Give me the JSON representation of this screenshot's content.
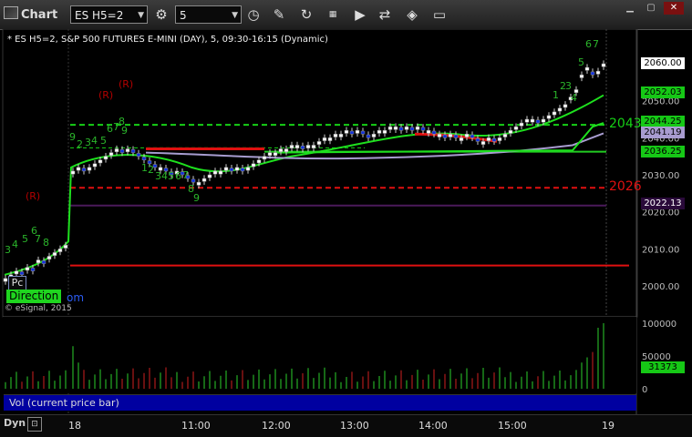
{
  "window": {
    "title": "Chart",
    "symbol_value": "ES H5=2",
    "interval_value": "5",
    "minimize_icon": "minimize-icon",
    "maximize_icon": "maximize-icon",
    "close_icon": "close-icon"
  },
  "toolbar": {
    "icons": [
      "link-settings-icon",
      "clock-icon",
      "pencil-icon",
      "refresh-icon",
      "quote-icon",
      "play-icon",
      "paint-bucket-icon",
      "chat-icon"
    ]
  },
  "header": {
    "text": "* ES H5=2, S&P 500 FUTURES E-MINI (DAY), 5, 09:30-16:15 (Dynamic)"
  },
  "chart_data": {
    "type": "candlestick",
    "price_ticks": [
      "2060.00",
      "2050.00",
      "2040.00",
      "2030.00",
      "2020.00",
      "2010.00",
      "2000.00"
    ],
    "volume_ticks": [
      "100000",
      "50000",
      "0"
    ],
    "time_labels": [
      "18",
      "11:00",
      "12:00",
      "13:00",
      "14:00",
      "15:00",
      "19"
    ],
    "price_tags": [
      {
        "label": "2060.00",
        "bg": "#ffffff",
        "fg": "#000000",
        "price": 2060.0
      },
      {
        "label": "2052.03",
        "bg": "#16c816",
        "fg": "#000000",
        "price": 2052.03
      },
      {
        "label": "2044.25",
        "bg": "#16c816",
        "fg": "#000000",
        "price": 2044.25
      },
      {
        "label": "2041.19",
        "bg": "#a89cd0",
        "fg": "#000000",
        "price": 2041.19
      },
      {
        "label": "2036.25",
        "bg": "#16c816",
        "fg": "#000000",
        "price": 2036.25
      },
      {
        "label": "2022.13",
        "bg": "#2a0a3a",
        "fg": "#ffffff",
        "price": 2022.13
      }
    ],
    "volume_tag": {
      "label": "31373",
      "bg": "#16c816",
      "fg": "#000000",
      "value": 31373
    },
    "pivot_levels": [
      {
        "label": "2043",
        "price": 2043.5,
        "color": "#16d016",
        "style": "dashed"
      },
      {
        "label": "2026",
        "price": 2026.5,
        "color": "#e01010",
        "style": "dashed"
      }
    ],
    "lines": [
      {
        "name": "prior_low",
        "price": 2005.5,
        "color": "#e01010"
      },
      {
        "name": "mid_green",
        "price": 2036.25,
        "color": "#22cc22"
      }
    ],
    "seq_labels_upper": [
      "3",
      "4",
      "5",
      "6",
      "7",
      "8",
      "9",
      "2",
      "3",
      "4",
      "5",
      "6",
      "7",
      "8",
      "9"
    ],
    "seq_labels_lower": [
      "1",
      "2",
      "3",
      "4",
      "5",
      "6",
      "7",
      "8",
      "9"
    ],
    "seq_labels_end": [
      "1",
      "2",
      "3",
      "4",
      "5",
      "6",
      "7"
    ],
    "r_marks": [
      "(R)",
      "(R)",
      "(R)"
    ]
  },
  "overlay": {
    "pc_label": "Pc",
    "direction_label": "Direction",
    "direction_tail": "om",
    "copyright": "© eSignal, 2015"
  },
  "volume_pane": {
    "label": "Vol (current price bar)"
  },
  "footer": {
    "dyn_label": "Dyn",
    "dyn_icon": "lock-icon"
  }
}
